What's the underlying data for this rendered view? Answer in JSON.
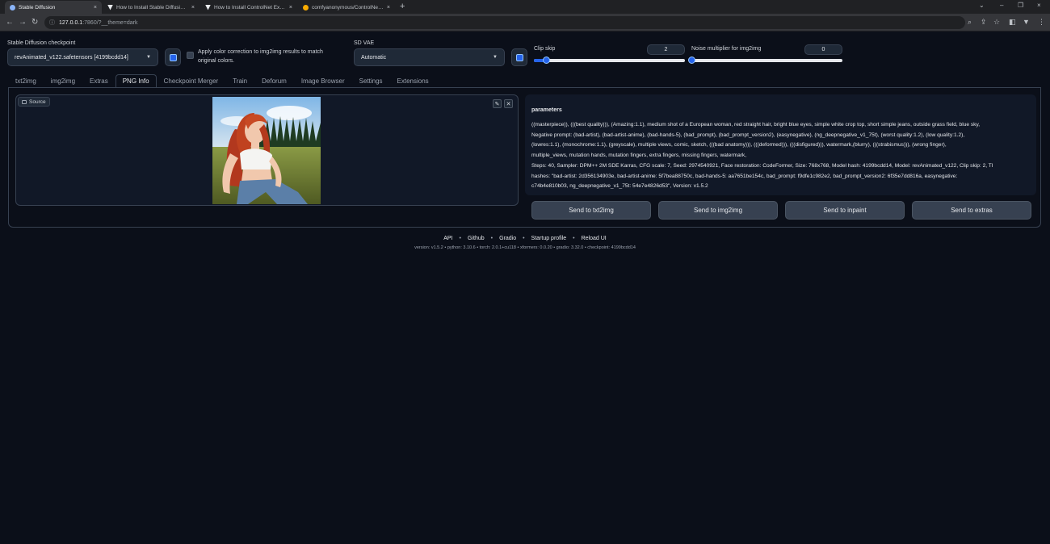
{
  "browser": {
    "tabs": [
      {
        "title": "Stable Diffusion",
        "active": true
      },
      {
        "title": "How to Install Stable Diffusion o",
        "active": false
      },
      {
        "title": "How to Install ControlNet Extens",
        "active": false
      },
      {
        "title": "comfyanonymous/ControlNet-v",
        "active": false
      }
    ],
    "new_tab": "+",
    "close_glyph": "×",
    "url_host": "127.0.0.1",
    "url_rest": ":7860/?__theme=dark"
  },
  "settings": {
    "checkpoint_label": "Stable Diffusion checkpoint",
    "checkpoint_value": "revAnimated_v122.safetensors [4199bcdd14]",
    "color_correction_label_1": "Apply color correction to img2img results to match",
    "color_correction_label_2": "original colors.",
    "sd_vae_label": "SD VAE",
    "sd_vae_value": "Automatic",
    "clip_skip_label": "Clip skip",
    "clip_skip_value": "2",
    "clip_skip_fraction": 0.08,
    "noise_label": "Noise multiplier for img2img",
    "noise_value": "0",
    "noise_fraction": 0.0
  },
  "tabs": [
    {
      "label": "txt2img",
      "active": false
    },
    {
      "label": "img2img",
      "active": false
    },
    {
      "label": "Extras",
      "active": false
    },
    {
      "label": "PNG Info",
      "active": true
    },
    {
      "label": "Checkpoint Merger",
      "active": false
    },
    {
      "label": "Train",
      "active": false
    },
    {
      "label": "Deforum",
      "active": false
    },
    {
      "label": "Image Browser",
      "active": false
    },
    {
      "label": "Settings",
      "active": false
    },
    {
      "label": "Extensions",
      "active": false
    }
  ],
  "source": {
    "label": "Source"
  },
  "parameters": {
    "title": "parameters",
    "lines": [
      "((masterpiece)), (((best quality))), (Amazing:1.1), medium shot of a European woman, red straight hair, bright blue eyes, simple white crop top, short simple jeans, outside grass field, blue sky,",
      "Negative prompt: (bad-artist), (bad-artist-anime), (bad-hands-5), (bad_prompt), (bad_prompt_version2), (easynegative), (ng_deepnegative_v1_75t), (worst quality:1.2), (low quality:1.2),",
      "(lowres:1.1), (monochrome:1.1), (greyscale), multiple views, comic, sketch, (((bad anatomy))), (((deformed))), (((disfigured))), watermark,(blurry), (((strabismus))), (wrong finger),",
      "multiple_views, mutation hands, mutation fingers, extra fingers, missing fingers, watermark,",
      "Steps: 40, Sampler: DPM++ 2M SDE Karras, CFG scale: 7, Seed: 2974540921, Face restoration: CodeFormer, Size: 768x768, Model hash: 4199bcdd14, Model: revAnimated_v122, Clip skip: 2, TI",
      "hashes: \"bad-artist: 2d356134903e, bad-artist-anime: 5f7bea88750c, bad-hands-5: aa7651be154c, bad_prompt: f9dfe1c982e2, bad_prompt_version2: 6f35e7dd816a, easynegative:",
      "c74b4e810b03, ng_deepnegative_v1_75t: 54e7e4826d53\", Version: v1.5.2"
    ]
  },
  "send_buttons": {
    "txt2img": "Send to txt2img",
    "img2img": "Send to img2img",
    "inpaint": "Send to inpaint",
    "extras": "Send to extras"
  },
  "footer": {
    "links": [
      "API",
      "Github",
      "Gradio",
      "Startup profile",
      "Reload UI"
    ],
    "separator": "•",
    "version_line": "version: v1.5.2  •  python: 3.10.6  •  torch: 2.0.1+cu118  •  xformers: 0.0.20  •  gradio: 3.32.0  •  checkpoint: 4199bcdd14"
  },
  "colors": {
    "background": "#0b0f19",
    "accent": "#2563eb",
    "panel": "#111827",
    "button": "#374151"
  },
  "icons": {
    "edit": "pencil-icon",
    "clear": "close-icon",
    "refresh_checkpoint": "refresh-icon",
    "refresh_vae": "refresh-icon"
  }
}
